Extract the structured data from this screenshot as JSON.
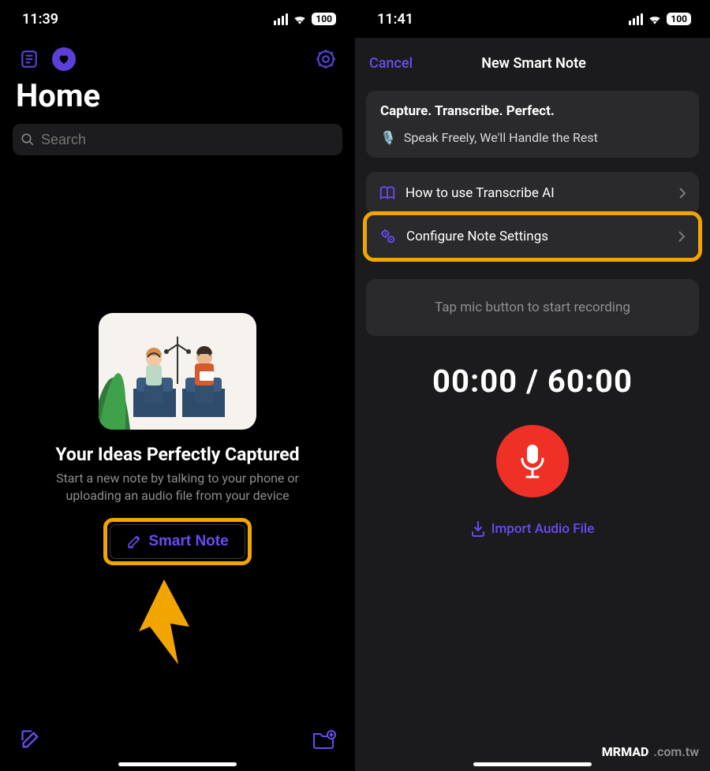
{
  "colors": {
    "accent": "#6a4af0",
    "highlight": "#f2a500",
    "record": "#ee3026"
  },
  "left": {
    "status": {
      "time": "11:39",
      "battery": "100"
    },
    "title": "Home",
    "search_placeholder": "Search",
    "hero": {
      "title": "Your Ideas Perfectly Captured",
      "subtitle": "Start a new note by talking to your phone or uploading an audio file from your device",
      "button_label": "Smart Note"
    },
    "icons": {
      "notes": "notes-icon",
      "heart": "heart-icon",
      "settings": "gear-icon",
      "compose": "compose-icon",
      "new_folder": "folder-plus-icon"
    }
  },
  "right": {
    "status": {
      "time": "11:41",
      "battery": "100"
    },
    "cancel_label": "Cancel",
    "modal_title": "New Smart Note",
    "info_card": {
      "title": "Capture. Transcribe. Perfect.",
      "subtitle": "Speak Freely, We'll Handle the Rest"
    },
    "rows": [
      {
        "label": "How to use Transcribe AI",
        "icon": "book-icon"
      },
      {
        "label": "Configure Note Settings",
        "icon": "gears-icon"
      }
    ],
    "hint": "Tap mic button to start recording",
    "timer": {
      "elapsed": "00:00",
      "sep": "/",
      "total": "60:00"
    },
    "import_label": "Import Audio File"
  },
  "watermark": {
    "brand": "MRMAD",
    "domain": ".com.tw"
  }
}
